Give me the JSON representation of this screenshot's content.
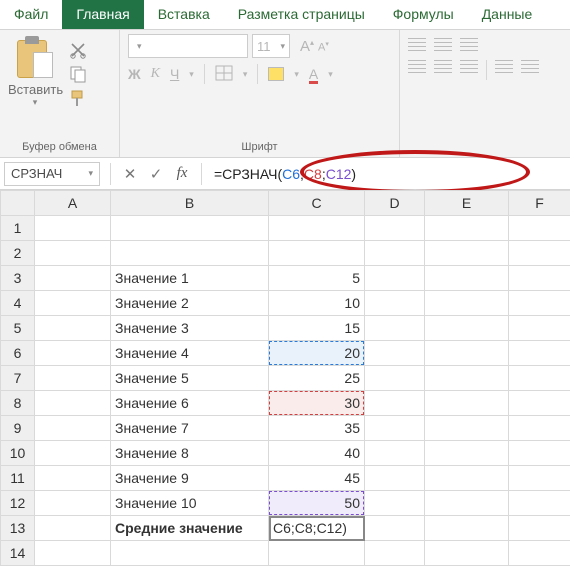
{
  "menu": {
    "tabs": [
      "Файл",
      "Главная",
      "Вставка",
      "Разметка страницы",
      "Формулы",
      "Данные"
    ],
    "active_index": 1
  },
  "ribbon": {
    "clipboard": {
      "paste_label": "Вставить",
      "group_label": "Буфер обмена"
    },
    "font": {
      "size_value": "11",
      "bold": "Ж",
      "italic": "К",
      "underline": "Ч",
      "group_label": "Шрифт"
    }
  },
  "formula_bar": {
    "name_box": "СРЗНАЧ",
    "cancel": "✕",
    "accept": "✓",
    "fx": "fx",
    "formula_tokens": [
      {
        "t": "=СРЗНАЧ(",
        "c": "plain"
      },
      {
        "t": "C6",
        "c": "blue"
      },
      {
        "t": ";",
        "c": "plain"
      },
      {
        "t": "C8",
        "c": "red"
      },
      {
        "t": ";",
        "c": "plain"
      },
      {
        "t": "C12",
        "c": "purple"
      },
      {
        "t": ")",
        "c": "plain"
      }
    ]
  },
  "sheet": {
    "columns": [
      "A",
      "B",
      "C",
      "D",
      "E",
      "F"
    ],
    "row_numbers": [
      1,
      2,
      3,
      4,
      5,
      6,
      7,
      8,
      9,
      10,
      11,
      12,
      13,
      14
    ],
    "rows": {
      "3": {
        "B": "Значение 1",
        "C": "5"
      },
      "4": {
        "B": "Значение 2",
        "C": "10"
      },
      "5": {
        "B": "Значение 3",
        "C": "15"
      },
      "6": {
        "B": "Значение 4",
        "C": "20"
      },
      "7": {
        "B": "Значение 5",
        "C": "25"
      },
      "8": {
        "B": "Значение 6",
        "C": "30"
      },
      "9": {
        "B": "Значение 7",
        "C": "35"
      },
      "10": {
        "B": "Значение 8",
        "C": "40"
      },
      "11": {
        "B": "Значение 9",
        "C": "45"
      },
      "12": {
        "B": "Значение 10",
        "C": "50"
      },
      "13": {
        "B": "Средние значение",
        "C": "C6;C8;C12)"
      }
    },
    "highlighted_cells": {
      "C6": "blue",
      "C8": "red",
      "C12": "purple"
    },
    "active_cell": "C13",
    "bold_cells": [
      "B13"
    ]
  }
}
